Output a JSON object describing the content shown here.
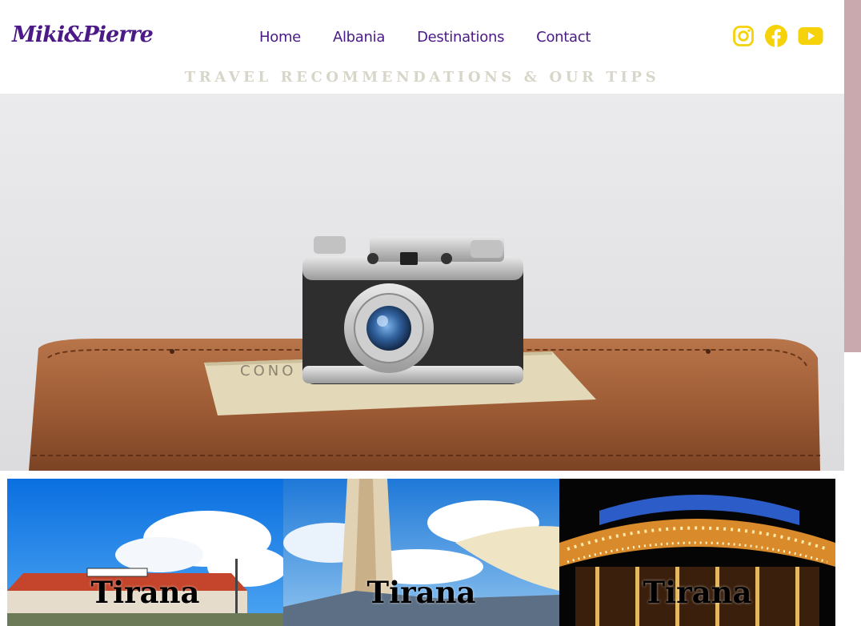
{
  "header": {
    "logo": "Miki&Pierre",
    "nav": [
      "Home",
      "Albania",
      "Destinations",
      "Contact"
    ],
    "social_icons": [
      "instagram-icon",
      "facebook-icon",
      "youtube-icon"
    ],
    "tagline": "TRAVEL RECOMMENDATIONS & OUR TIPS"
  },
  "hero": {
    "image": "vintage-camera-on-suitcase"
  },
  "tiles": [
    {
      "label": "Tirana",
      "image": "building-with-sky"
    },
    {
      "label": "Tirana",
      "image": "parasol-cafe-sky"
    },
    {
      "label": "Tirana",
      "image": "carousel-night"
    }
  ],
  "colors": {
    "brand_purple": "#4b1a86",
    "icon_yellow": "#f5d20a",
    "tagline_gray": "#d8d6c9",
    "side_strip": "#c9a9ae"
  }
}
